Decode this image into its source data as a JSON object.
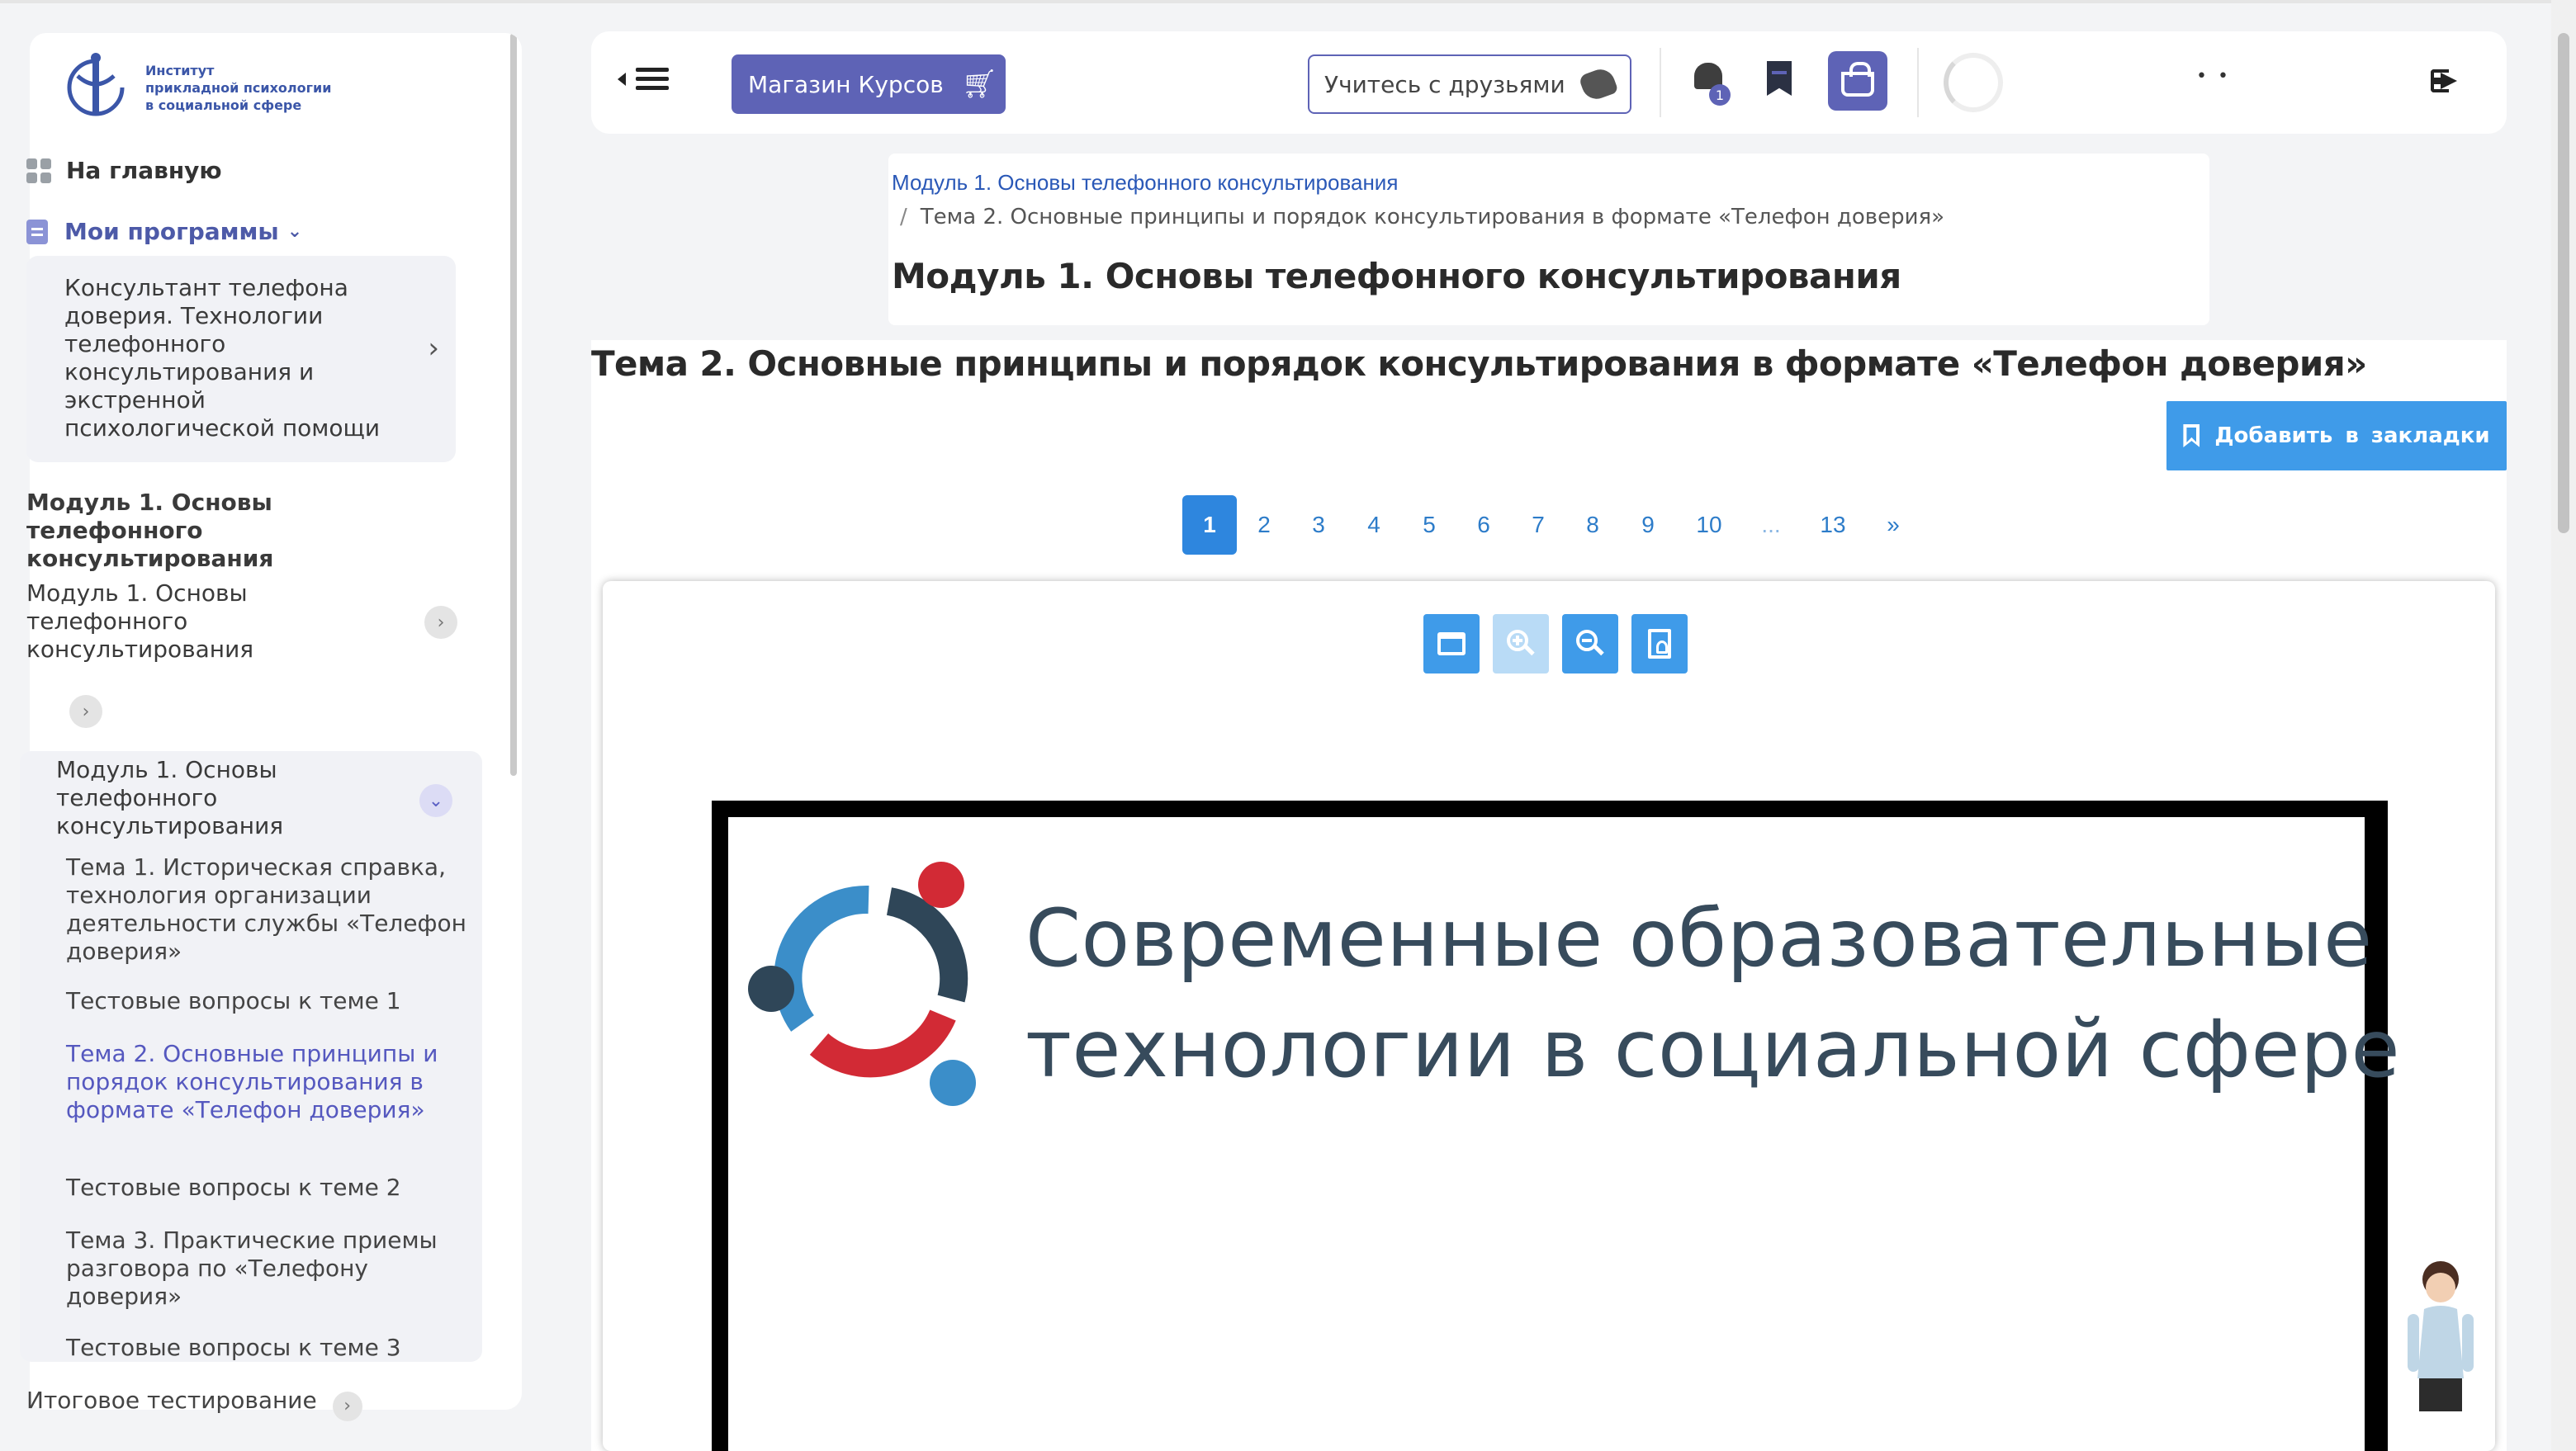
{
  "sidebar": {
    "logo_lines": [
      "Институт",
      "прикладной психологии",
      "в социальной сфере"
    ],
    "home_label": "На главную",
    "programs_label": "Мои программы",
    "course_name": "Консультант телефона доверия. Технологии телефонного консультирования и экстренной психологической помощи",
    "section_title": "Модуль 1. Основы телефонного консультирования",
    "module_item_1": "Модуль 1. Основы телефонного консультирования",
    "module_item_2": "Модуль 1. Основы телефонного консультирования",
    "topics": [
      {
        "label": "Тема 1. Историческая справка, технология организации деятельности службы «Телефон доверия»",
        "active": false
      },
      {
        "label": "Тестовые вопросы к теме 1",
        "active": false
      },
      {
        "label": "Тема 2. Основные принципы и порядок консультирования в формате «Телефон доверия»",
        "active": true
      },
      {
        "label": "Тестовые вопросы к теме 2",
        "active": false
      },
      {
        "label": "Тема 3. Практические приемы разговора по «Телефону доверия»",
        "active": false
      },
      {
        "label": "Тестовые вопросы к теме 3",
        "active": false
      }
    ],
    "final_test": "Итоговое тестирование"
  },
  "topbar": {
    "shop_label": "Магазин Курсов",
    "friends_label": "Учитесь с друзьями",
    "notification_count": "1",
    "user_dots": "• •"
  },
  "breadcrumb": {
    "module_link": "Модуль 1. Основы телефонного консультирования",
    "separator": "/",
    "current": "Тема 2. Основные принципы и порядок консультирования в формате «Телефон доверия»"
  },
  "module_title": "Модуль 1. Основы телефонного консультирования",
  "topic_title": "Тема 2. Основные принципы и порядок консультирования в формате «Телефон доверия»",
  "bookmark_label": "Добавить в закладки",
  "pagination": [
    "1",
    "2",
    "3",
    "4",
    "5",
    "6",
    "7",
    "8",
    "9",
    "10",
    "...",
    "13",
    "»"
  ],
  "current_page": "1",
  "viewer": {
    "tools": [
      "window-icon",
      "zoom-in-icon",
      "zoom-out-icon",
      "pdf-icon"
    ],
    "slide_text_lines": [
      "Современные образовательные",
      "технологии в социальной сфере"
    ]
  },
  "colors": {
    "accent": "#5e63b6",
    "primary_blue": "#3f9be9",
    "link_blue": "#2a58b7",
    "slide_text": "#374b5c",
    "slide_logo_blue": "#3b8ec9",
    "slide_logo_red": "#d22a35",
    "slide_logo_dark": "#2f4658"
  }
}
